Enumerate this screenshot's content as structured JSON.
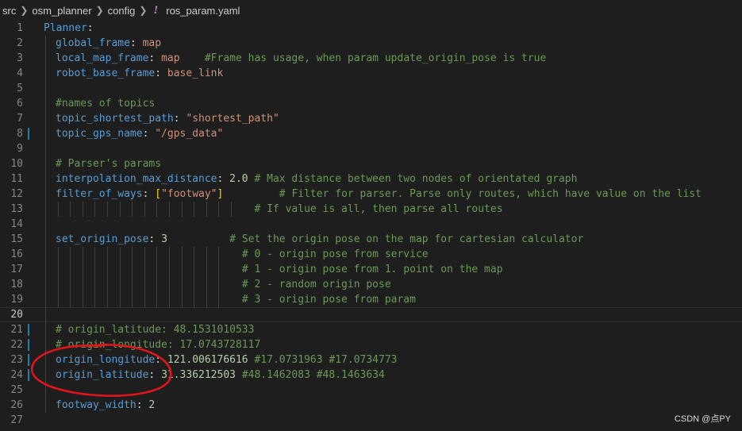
{
  "breadcrumb": {
    "items": [
      "src",
      "osm_planner",
      "config"
    ],
    "file_icon": "!",
    "file": "ros_param.yaml"
  },
  "lines": [
    {
      "n": "1",
      "tokens": [
        [
          "k",
          "Planner"
        ],
        [
          "p",
          ":"
        ]
      ]
    },
    {
      "n": "2",
      "tokens": [
        [
          "k",
          "global_frame"
        ],
        [
          "p",
          ": "
        ],
        [
          "s",
          "map"
        ]
      ]
    },
    {
      "n": "3",
      "tokens": [
        [
          "k",
          "local_map_frame"
        ],
        [
          "p",
          ": "
        ],
        [
          "s",
          "map"
        ],
        [
          "p",
          "    "
        ],
        [
          "c",
          "#Frame has usage, when param update_origin_pose is true"
        ]
      ]
    },
    {
      "n": "4",
      "tokens": [
        [
          "k",
          "robot_base_frame"
        ],
        [
          "p",
          ": "
        ],
        [
          "s",
          "base_link"
        ]
      ]
    },
    {
      "n": "5",
      "tokens": []
    },
    {
      "n": "6",
      "tokens": [
        [
          "c",
          "#names of topics"
        ]
      ]
    },
    {
      "n": "7",
      "tokens": [
        [
          "k",
          "topic_shortest_path"
        ],
        [
          "p",
          ": "
        ],
        [
          "s",
          "\"shortest_path\""
        ]
      ]
    },
    {
      "n": "8",
      "tokens": [
        [
          "k",
          "topic_gps_name"
        ],
        [
          "p",
          ": "
        ],
        [
          "s",
          "\"/gps_data\""
        ]
      ]
    },
    {
      "n": "9",
      "tokens": []
    },
    {
      "n": "10",
      "tokens": [
        [
          "c",
          "# Parser's params"
        ]
      ]
    },
    {
      "n": "11",
      "tokens": [
        [
          "k",
          "interpolation_max_distance"
        ],
        [
          "p",
          ": "
        ],
        [
          "n",
          "2.0"
        ],
        [
          "p",
          " "
        ],
        [
          "c",
          "# Max distance between two nodes of orientated graph"
        ]
      ]
    },
    {
      "n": "12",
      "tokens": [
        [
          "k",
          "filter_of_ways"
        ],
        [
          "p",
          ": "
        ],
        [
          "b",
          "["
        ],
        [
          "s",
          "\"footway\""
        ],
        [
          "b",
          "]"
        ],
        [
          "p",
          "         "
        ],
        [
          "c",
          "# Filter for parser. Parse only routes, which have value on the list"
        ]
      ]
    },
    {
      "n": "13",
      "tokens": [
        [
          "p",
          "                                "
        ],
        [
          "c",
          "# If value is all, then parse all routes"
        ]
      ]
    },
    {
      "n": "14",
      "tokens": []
    },
    {
      "n": "15",
      "tokens": [
        [
          "k",
          "set_origin_pose"
        ],
        [
          "p",
          ": "
        ],
        [
          "n",
          "3"
        ],
        [
          "p",
          "          "
        ],
        [
          "c",
          "# Set the origin pose on the map for cartesian calculator"
        ]
      ]
    },
    {
      "n": "16",
      "tokens": [
        [
          "p",
          "                              "
        ],
        [
          "c",
          "# 0 - origin pose from service"
        ]
      ]
    },
    {
      "n": "17",
      "tokens": [
        [
          "p",
          "                              "
        ],
        [
          "c",
          "# 1 - origin pose from 1. point on the map"
        ]
      ]
    },
    {
      "n": "18",
      "tokens": [
        [
          "p",
          "                              "
        ],
        [
          "c",
          "# 2 - random origin pose"
        ]
      ]
    },
    {
      "n": "19",
      "tokens": [
        [
          "p",
          "                              "
        ],
        [
          "c",
          "# 3 - origin pose from param"
        ]
      ]
    },
    {
      "n": "20",
      "tokens": []
    },
    {
      "n": "21",
      "tokens": [
        [
          "c",
          "# origin_latitude: 48.1531010533"
        ]
      ]
    },
    {
      "n": "22",
      "tokens": [
        [
          "c",
          "# origin_longitude: 17.0743728117"
        ]
      ]
    },
    {
      "n": "23",
      "tokens": [
        [
          "k",
          "origin_longitude"
        ],
        [
          "p",
          ": "
        ],
        [
          "n",
          "121.006176616"
        ],
        [
          "p",
          " "
        ],
        [
          "c",
          "#17.0731963 #17.0734773"
        ]
      ]
    },
    {
      "n": "24",
      "tokens": [
        [
          "k",
          "origin_latitude"
        ],
        [
          "p",
          ": "
        ],
        [
          "n",
          "31.336212503"
        ],
        [
          "p",
          " "
        ],
        [
          "c",
          "#48.1462083 #48.1463634"
        ]
      ]
    },
    {
      "n": "25",
      "tokens": []
    },
    {
      "n": "26",
      "tokens": [
        [
          "k",
          "footway_width"
        ],
        [
          "p",
          ": "
        ],
        [
          "n",
          "2"
        ]
      ]
    },
    {
      "n": "27",
      "tokens": []
    }
  ],
  "current_line": "20",
  "modified_lines": [
    "8",
    "21",
    "22",
    "23",
    "24"
  ],
  "watermark": "CSDN @点PY",
  "colors": {
    "background": "#1e1e1e",
    "key": "#569cd6",
    "string": "#ce9178",
    "number": "#b5cea8",
    "comment": "#6a9955",
    "bracket": "#ffd700",
    "annotation": "#e0151b"
  }
}
